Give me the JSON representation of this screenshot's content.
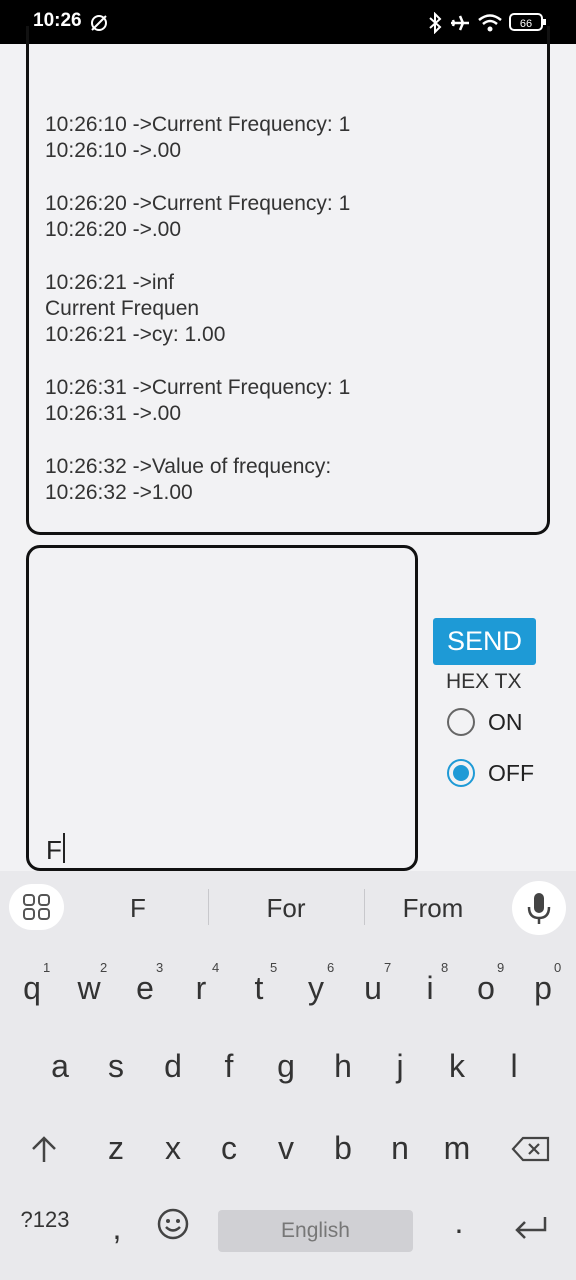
{
  "status_bar": {
    "time": "10:26",
    "icons": [
      "app-notification-icon",
      "bluetooth-icon",
      "airplane-icon",
      "wifi-icon",
      "battery-icon"
    ],
    "battery_level": "66"
  },
  "log": {
    "lines": [
      "10:26:10 ->Current Frequency: 1",
      "10:26:10 ->.00",
      "",
      "10:26:20 ->Current Frequency: 1",
      "10:26:20 ->.00",
      "",
      "10:26:21 ->inf",
      "Current Frequen",
      "10:26:21 ->cy: 1.00",
      "",
      "10:26:31 ->Current Frequency: 1",
      "10:26:31 ->.00",
      "",
      "10:26:32 ->Value of frequency:",
      "10:26:32 ->1.00"
    ]
  },
  "input": {
    "value": "F"
  },
  "controls": {
    "send_label": "SEND",
    "hex_tx_label": "HEX TX",
    "options": [
      {
        "label": "ON",
        "selected": false
      },
      {
        "label": "OFF",
        "selected": true
      }
    ],
    "accent_color": "#1e9ad6"
  },
  "keyboard": {
    "suggestions": [
      "F",
      "For",
      "From"
    ],
    "row1": [
      "q",
      "w",
      "e",
      "r",
      "t",
      "y",
      "u",
      "i",
      "o",
      "p"
    ],
    "row1_hints": [
      "1",
      "2",
      "3",
      "4",
      "5",
      "6",
      "7",
      "8",
      "9",
      "0"
    ],
    "row2": [
      "a",
      "s",
      "d",
      "f",
      "g",
      "h",
      "j",
      "k",
      "l"
    ],
    "row3": [
      "z",
      "x",
      "c",
      "v",
      "b",
      "n",
      "m"
    ],
    "symbols_label": "?123",
    "comma": ",",
    "period": ".",
    "space_label": "English"
  }
}
